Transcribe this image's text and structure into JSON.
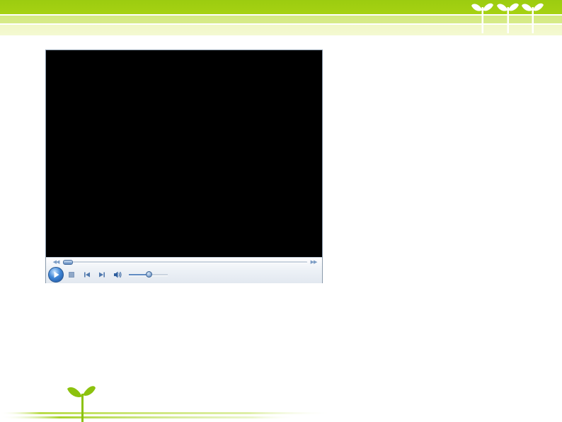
{
  "media": {
    "seek_progress_percent": 0,
    "volume_percent": 50
  },
  "icons": {
    "rewind": "rewind-icon",
    "fast_forward": "fast-forward-icon",
    "play": "play-icon",
    "stop": "stop-icon",
    "previous": "previous-track-icon",
    "next": "next-track-icon",
    "volume": "speaker-icon",
    "decoration": "sprout-icon"
  },
  "colors": {
    "accent_green": "#9ccc10",
    "player_blue": "#3f86d6",
    "video_background": "#000000"
  }
}
